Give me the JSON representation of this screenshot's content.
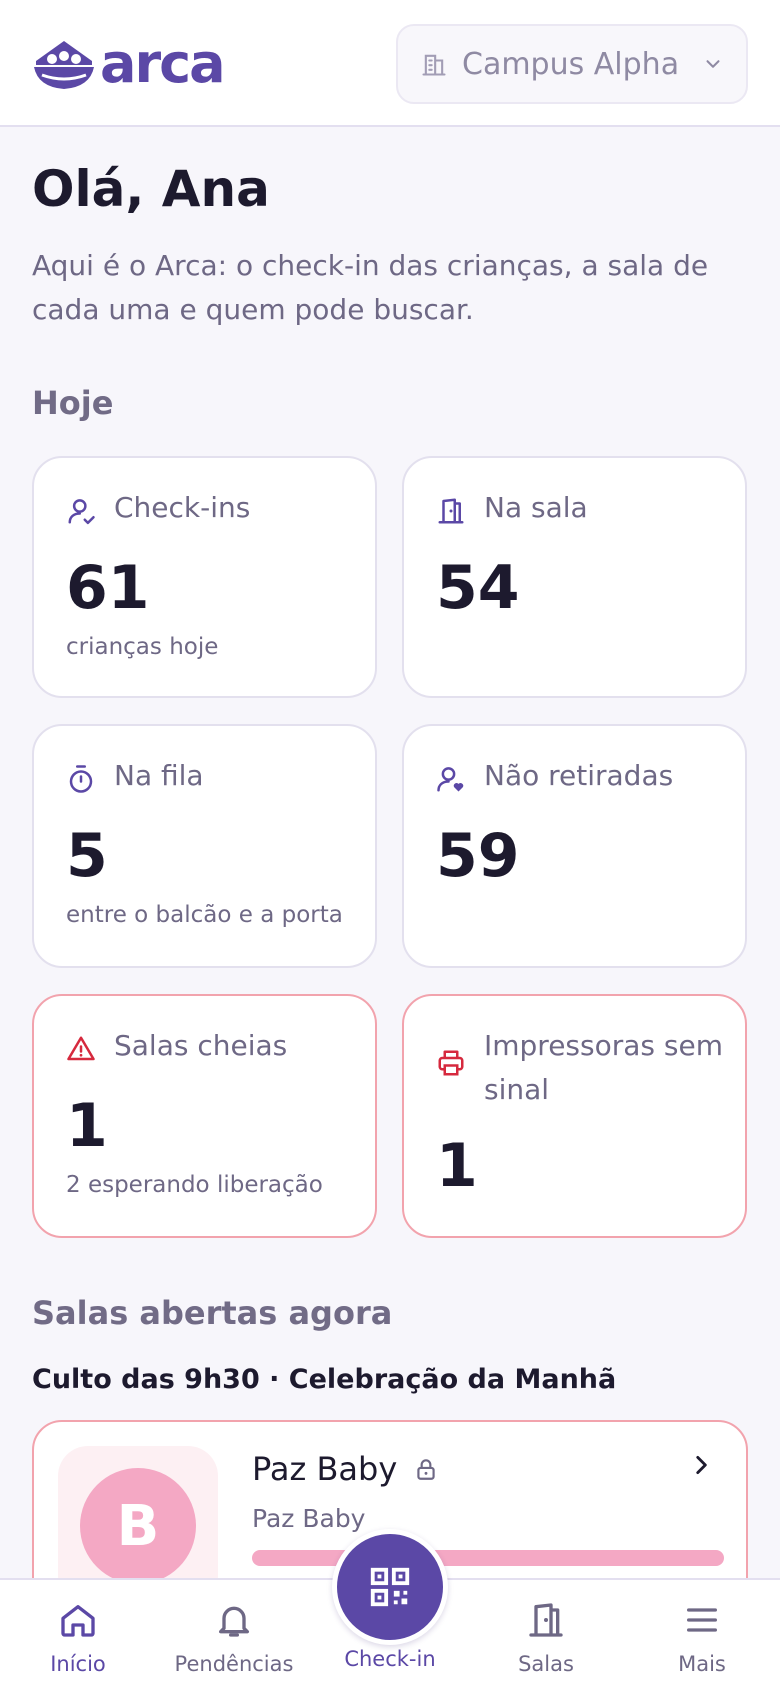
{
  "header": {
    "brand": "arca",
    "campus": "Campus Alpha"
  },
  "greeting": "Olá, Ana",
  "intro": "Aqui é o Arca: o check-in das crianças, a sala de cada uma e quem pode buscar.",
  "today": {
    "title": "Hoje",
    "cards": [
      {
        "label": "Check-ins",
        "value": "61",
        "sub": "crianças hoje",
        "icon": "user-check-icon"
      },
      {
        "label": "Na sala",
        "value": "54",
        "sub": "",
        "icon": "door-icon"
      },
      {
        "label": "Na fila",
        "value": "5",
        "sub": "entre o balcão e a porta",
        "icon": "timer-icon"
      },
      {
        "label": "Não retiradas",
        "value": "59",
        "sub": "",
        "icon": "user-heart-icon"
      },
      {
        "label": "Salas cheias",
        "value": "1",
        "sub": "2 esperando liberação",
        "icon": "warning-icon"
      },
      {
        "label": "Impressoras sem sinal",
        "value": "1",
        "sub": "",
        "icon": "printer-icon"
      }
    ]
  },
  "open_rooms": {
    "title": "Salas abertas agora",
    "service": "Culto das 9h30 · Celebração da Manhã",
    "rooms": [
      {
        "initial": "B",
        "name": "Paz Baby",
        "subtitle": "Paz Baby",
        "occupancy_fraction": 1.0
      }
    ]
  },
  "nav": {
    "items": [
      "Início",
      "Pendências",
      "Check-in",
      "Salas",
      "Mais"
    ],
    "active": "Início"
  },
  "colors": {
    "brand": "#5b48a6",
    "alert_border": "#f2a3ad",
    "alert_icon": "#d6293e",
    "room_pink": "#f4a8c4"
  }
}
